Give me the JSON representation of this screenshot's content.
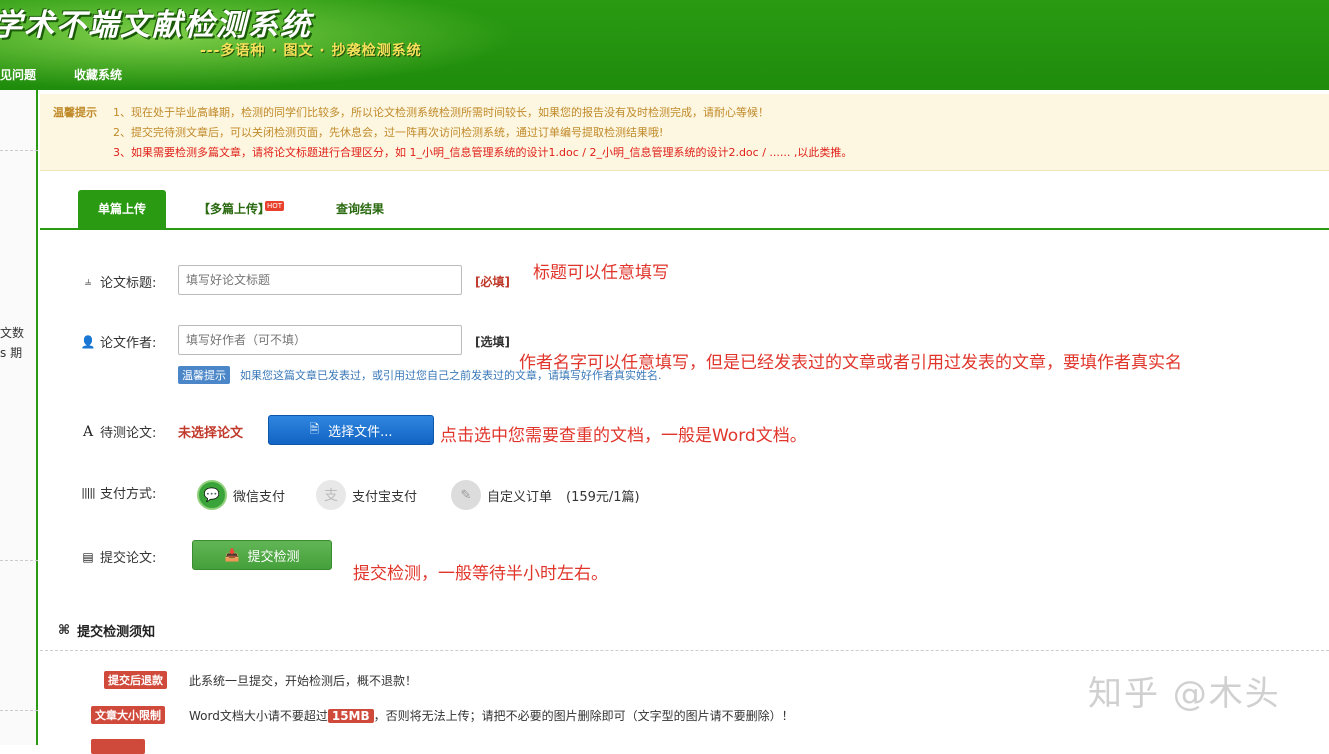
{
  "header": {
    "title": "学术不端文献检测系统",
    "subtitle": "---多语种 · 图文 · 抄袭检测系统",
    "nav": [
      "见问题",
      "收藏系统"
    ]
  },
  "left_rail": {
    "snippets": [
      "文数",
      "s 期"
    ]
  },
  "notice": {
    "label": "温馨提示",
    "lines": [
      "1、现在处于毕业高峰期，检测的同学们比较多，所以论文检测系统检测所需时间较长，如果您的报告没有及时检测完成，请耐心等候！",
      "2、提交完待测文章后，可以关闭检测页面，先休息会，过一阵再次访问检测系统，通过订单编号提取检测结果哦!",
      "3、如果需要检测多篇文章，请将论文标题进行合理区分，如 1_小明_信息管理系统的设计1.doc / 2_小明_信息管理系统的设计2.doc / ...... ,以此类推。"
    ]
  },
  "tabs": {
    "single": "单篇上传",
    "multi": "【多篇上传】",
    "hot": "HOT",
    "query": "查询结果"
  },
  "form": {
    "title_label": "论文标题:",
    "title_placeholder": "填写好论文标题",
    "title_required": "[必填]",
    "author_label": "论文作者:",
    "author_placeholder": "填写好作者（可不填）",
    "author_optional": "[选填]",
    "tip_badge": "温馨提示",
    "tip_text": "如果您这篇文章已发表过，或引用过您自己之前发表过的文章，请填写好作者真实姓名.",
    "file_label": "待测论文:",
    "file_status": "未选择论文",
    "file_button": "选择文件...",
    "pay_label": "支付方式:",
    "pay_options": [
      "微信支付",
      "支付宝支付",
      "自定义订单"
    ],
    "price": "(159元/1篇)",
    "submit_label": "提交论文:",
    "submit_button": "提交检测"
  },
  "annotations": {
    "title_note": "标题可以任意填写",
    "author_note": "作者名字可以任意填写，但是已经发表过的文章或者引用过发表的文章，要填作者真实名",
    "file_note": "点击选中您需要查重的文档，一般是Word文档。",
    "submit_note": "提交检测，一般等待半小时左右。"
  },
  "rules": {
    "section_title": "提交检测须知",
    "items": [
      {
        "badge": "提交后退款",
        "text": "此系统一旦提交，开始检测后，概不退款！"
      },
      {
        "badge": "文章大小限制",
        "text_pre": "Word文档大小请不要超过",
        "size": "15MB",
        "text_post": "，否则将无法上传；请把不必要的图片删除即可（文字型的图片请不要删除）！"
      }
    ]
  },
  "watermark": "知乎 @木头",
  "colors": {
    "brand_green": "#2a9a12",
    "warning_red": "#e0201a",
    "annotation_red": "#e0352b",
    "file_blue": "#1a6fd0"
  }
}
